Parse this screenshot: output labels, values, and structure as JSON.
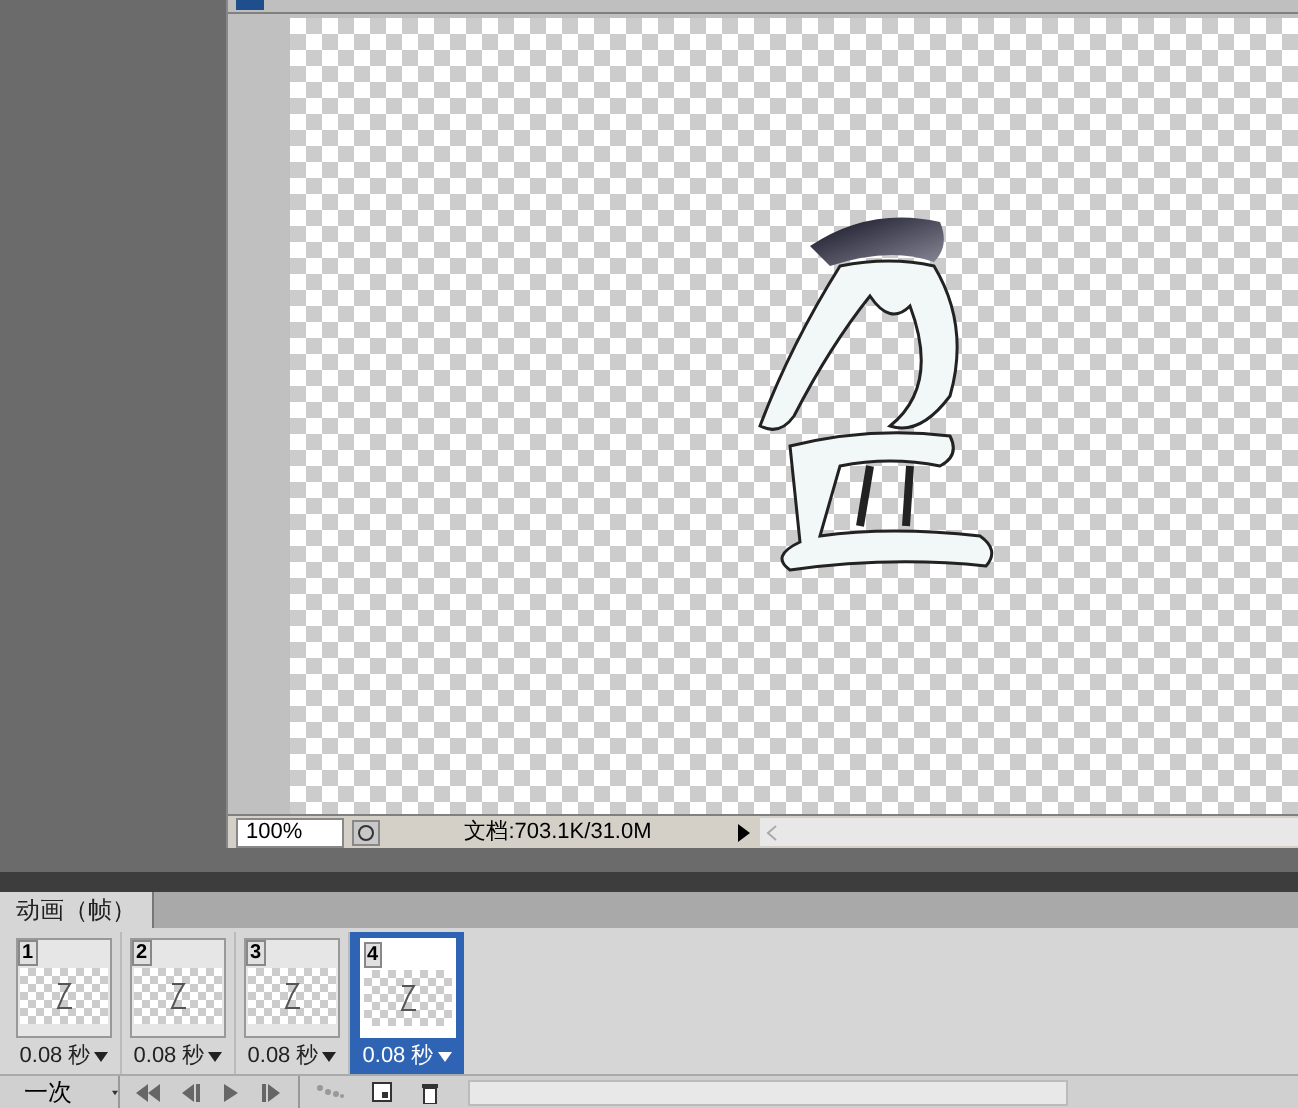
{
  "document": {
    "zoom": "100%",
    "doc_info": "文档:703.1K/31.0M"
  },
  "animation_panel": {
    "tab": {
      "label": "动画（帧）",
      "selected": true
    },
    "frames": [
      {
        "number": "1",
        "delay": "0.08 秒",
        "selected": false
      },
      {
        "number": "2",
        "delay": "0.08 秒",
        "selected": false
      },
      {
        "number": "3",
        "delay": "0.08 秒",
        "selected": false
      },
      {
        "number": "4",
        "delay": "0.08 秒",
        "selected": true
      }
    ],
    "loop": "一次"
  }
}
